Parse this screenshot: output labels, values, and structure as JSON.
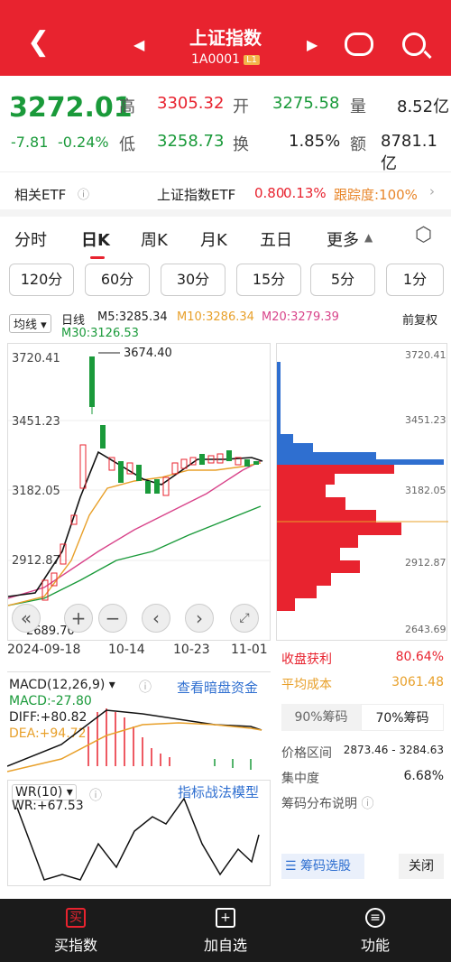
{
  "header": {
    "title": "上证指数",
    "code": "1A0001",
    "level": "L1",
    "back_icon": "back-arrow-icon"
  },
  "quote": {
    "price": "3272.01",
    "change": "-7.81",
    "change_pct": "-0.24%",
    "high_label": "高",
    "high": "3305.32",
    "low_label": "低",
    "low": "3258.73",
    "open_label": "开",
    "open": "3275.58",
    "turnover_label": "换",
    "turnover": "1.85%",
    "volume_label": "量",
    "volume": "8.52亿",
    "amount_label": "额",
    "amount": "8781.1亿"
  },
  "etf": {
    "label": "相关ETF",
    "name": "上证指数ETF",
    "price": "0.80",
    "pct": "0.13%",
    "track": "跟踪度:100%"
  },
  "tabs": [
    "分时",
    "日K",
    "周K",
    "月K",
    "五日",
    "更多"
  ],
  "minutes": [
    "120分",
    "60分",
    "30分",
    "15分",
    "5分",
    "1分"
  ],
  "legend": {
    "select": "均线",
    "period": "日线",
    "ma5": "M5:3285.34",
    "ma10": "M10:3286.34",
    "ma20": "M20:3279.39",
    "ma30": "M30:3126.53",
    "adj": "前复权"
  },
  "chart": {
    "ticks": [
      "3720.41",
      "3451.23",
      "3182.05",
      "2912.87"
    ],
    "high_mark": "3674.40",
    "low_mark": "2689.70",
    "low_mark_left": "2643.69",
    "dates": [
      "2024-09-18",
      "10-14",
      "10-23",
      "11-01"
    ]
  },
  "chip": {
    "ticks": [
      "3720.41",
      "3451.23",
      "3182.05",
      "2912.87",
      "2643.69"
    ]
  },
  "stats": {
    "profit_label": "收盘获利",
    "profit": "80.64%",
    "avg_label": "平均成本",
    "avg": "3061.48",
    "tab90": "90%筹码",
    "tab70": "70%筹码",
    "range_label": "价格区间",
    "range": "2873.46 - 3284.63",
    "conc_label": "集中度",
    "conc": "6.68%",
    "explain": "筹码分布说明",
    "select_btn": "筹码选股",
    "close_btn": "关闭"
  },
  "macd": {
    "name": "MACD(12,26,9)",
    "link": "查看暗盘资金",
    "macd": "MACD:-27.80",
    "diff": "DIFF:+80.82",
    "dea": "DEA:+94.72"
  },
  "wr": {
    "name": "WR(10)",
    "link": "指标战法模型",
    "value": "WR:+67.53"
  },
  "bottom": {
    "buy": "买指数",
    "add": "加自选",
    "func": "功能"
  },
  "colors": {
    "red": "#e8232f",
    "green": "#1a9a3a",
    "blue": "#2f6fd0",
    "orange": "#e8a02a",
    "pink": "#d8448a"
  }
}
